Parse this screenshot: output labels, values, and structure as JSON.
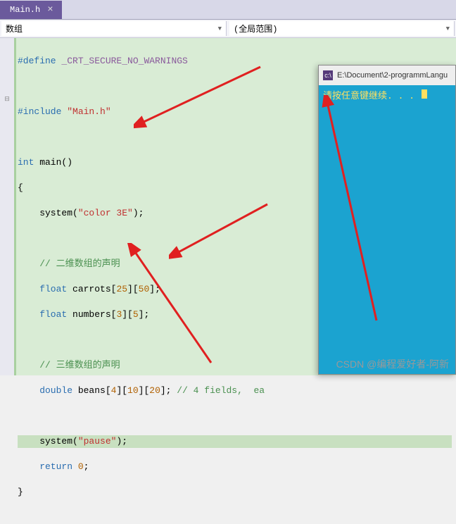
{
  "tab": {
    "filename": "Main.h",
    "close": "×"
  },
  "toolbar": {
    "left_combo": "数组",
    "right_combo": "(全局范围)"
  },
  "code": {
    "l1a": "#define ",
    "l1b": "_CRT_SECURE_NO_WARNINGS",
    "l3a": "#include ",
    "l3b": "\"Main.h\"",
    "l5a": "int",
    "l5b": " main()",
    "l6": "{",
    "l7a": "    system(",
    "l7b": "\"color 3E\"",
    "l7c": ");",
    "l9": "    // 二维数组的声明",
    "l10a": "    float",
    "l10b": " carrots[",
    "l10c": "25",
    "l10d": "][",
    "l10e": "50",
    "l10f": "];",
    "l11a": "    float",
    "l11b": " numbers[",
    "l11c": "3",
    "l11d": "][",
    "l11e": "5",
    "l11f": "];",
    "l13": "    // 三维数组的声明",
    "l14a": "    double",
    "l14b": " beans[",
    "l14c": "4",
    "l14d": "][",
    "l14e": "10",
    "l14f": "][",
    "l14g": "20",
    "l14h": "]; ",
    "l14i": "// 4 fields,  ea",
    "l16a": "    system(",
    "l16b": "\"pause\"",
    "l16c": ");",
    "l17a": "    return ",
    "l17b": "0",
    "l17c": ";",
    "l18": "}"
  },
  "console": {
    "title": "E:\\Document\\2-programmLangu",
    "message": "请按任意键继续. . . "
  },
  "watermark": "CSDN @编程爱好者-阿新"
}
